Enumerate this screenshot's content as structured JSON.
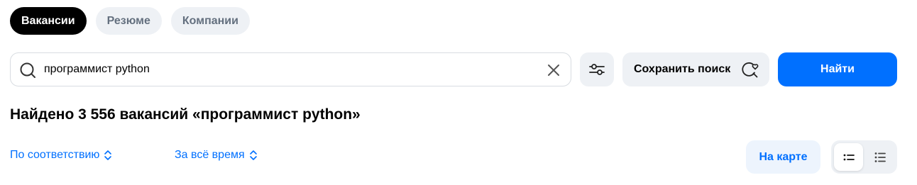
{
  "tabs": [
    {
      "label": "Вакансии",
      "active": true
    },
    {
      "label": "Резюме",
      "active": false
    },
    {
      "label": "Компании",
      "active": false
    }
  ],
  "search": {
    "value": "программист python",
    "icon": "search-icon",
    "clear_icon": "close-icon"
  },
  "toolbar": {
    "filter_icon": "sliders-icon",
    "save_label": "Сохранить поиск",
    "save_icon": "search-heart-icon",
    "find_label": "Найти"
  },
  "results": {
    "title": "Найдено 3 556 вакансий «программист python»"
  },
  "sorting": {
    "order_label": "По соответствию",
    "period_label": "За всё время"
  },
  "view": {
    "map_label": "На карте",
    "compact_icon": "list-compact-icon",
    "detailed_icon": "list-detailed-icon"
  },
  "colors": {
    "accent": "#0070ff",
    "chip_bg": "#eef1f5",
    "active_tab_bg": "#000000"
  }
}
